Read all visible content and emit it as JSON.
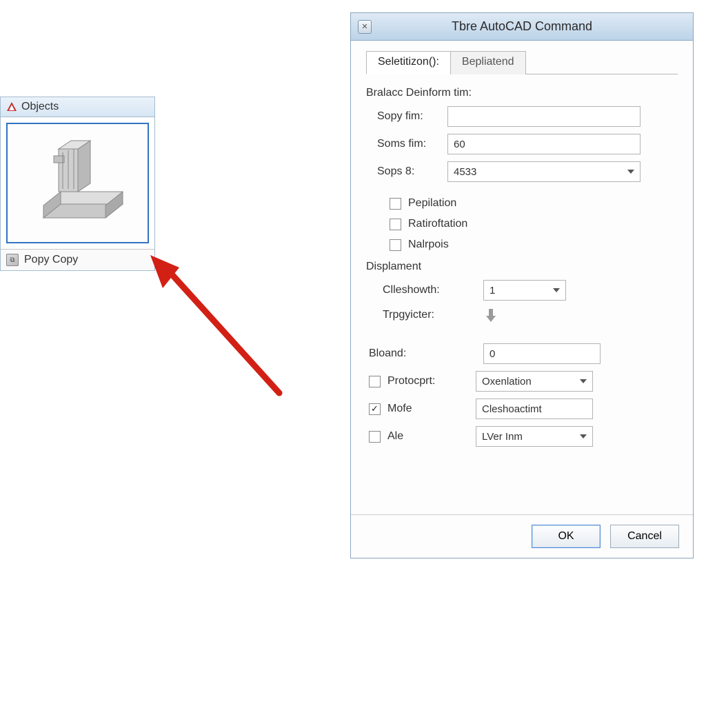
{
  "objects_panel": {
    "title": "Objects",
    "copy_label": "Popy Copy"
  },
  "arrow": {
    "color": "#d22015"
  },
  "dialog": {
    "title": "Tbre AutoCAD Command",
    "tabs": [
      {
        "label": "Seletitizon():",
        "active": true
      },
      {
        "label": "Bepliatend",
        "active": false
      }
    ],
    "section1": {
      "heading": "Bralacc Deinform tim:",
      "rows": [
        {
          "label": "Sopy fim:",
          "value": ""
        },
        {
          "label": "Soms fim:",
          "value": "60"
        }
      ],
      "select": {
        "label": "Sops 8:",
        "value": "4533"
      }
    },
    "checks1": [
      {
        "label": "Pepilation",
        "checked": false
      },
      {
        "label": "Ratiroftation",
        "checked": false
      },
      {
        "label": "Nalrpois",
        "checked": false
      }
    ],
    "section2": {
      "heading": "Displament",
      "select": {
        "label": "Clleshowth:",
        "value": "1"
      },
      "trigger_label": "Trpgyicter:"
    },
    "section3": {
      "bloand": {
        "label": "Bloand:",
        "value": "0"
      },
      "rows": [
        {
          "label": "Protocprt:",
          "value": "Oxenlation",
          "checked": false,
          "is_select": true
        },
        {
          "label": "Mofe",
          "value": "Cleshoactimt",
          "checked": true,
          "is_select": false
        },
        {
          "label": "Ale",
          "value": "LVer Inm",
          "checked": false,
          "is_select": true
        }
      ]
    },
    "buttons": {
      "ok": "OK",
      "cancel": "Cancel"
    }
  }
}
